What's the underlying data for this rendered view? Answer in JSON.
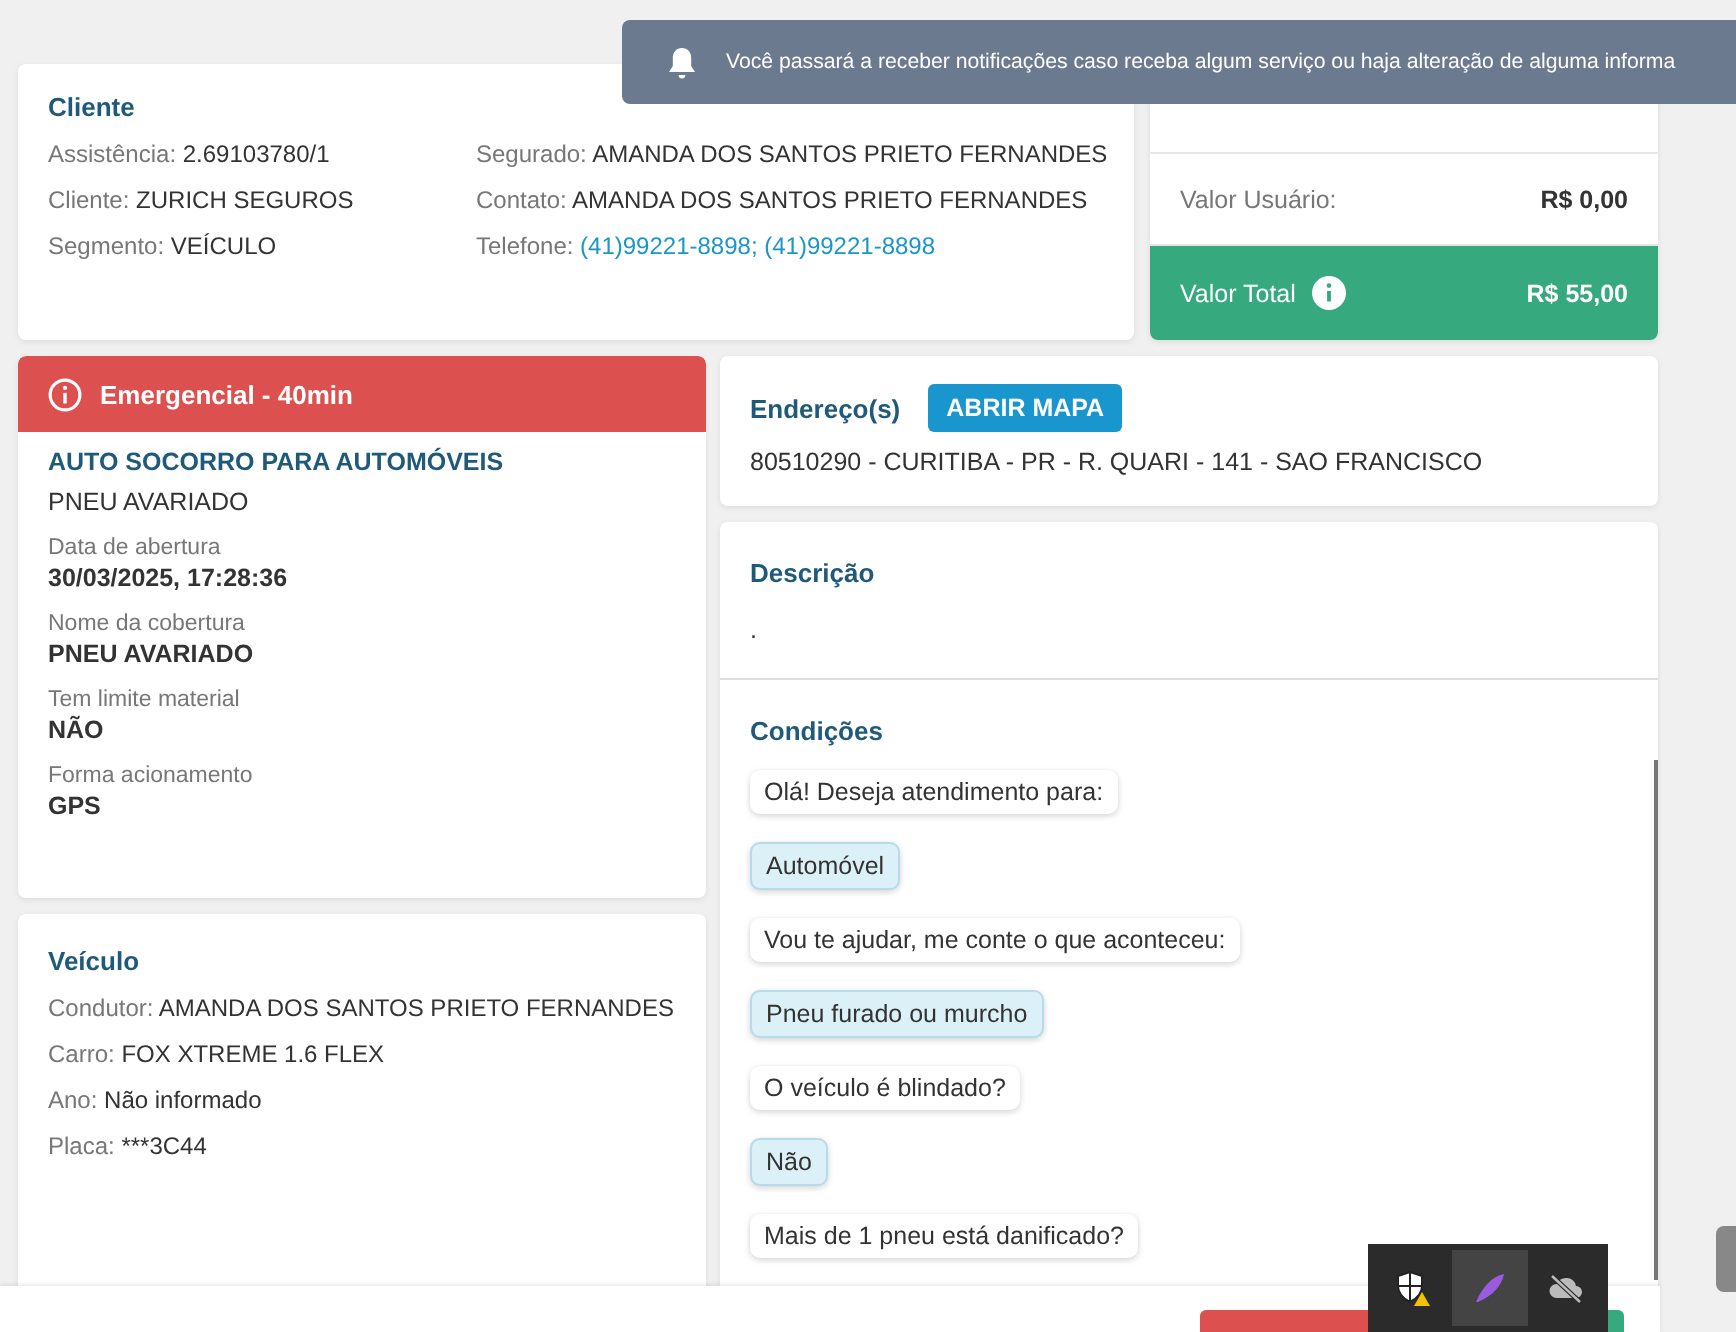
{
  "toast": {
    "text": "Você passará a receber notificações caso receba algum serviço ou haja alteração de alguma informa"
  },
  "client": {
    "title": "Cliente",
    "left": [
      {
        "label": "Assistência:",
        "value": "2.69103780/1"
      },
      {
        "label": "Cliente:",
        "value": "ZURICH SEGUROS"
      },
      {
        "label": "Segmento:",
        "value": "VEÍCULO"
      }
    ],
    "right": [
      {
        "label": "Segurado:",
        "value": "AMANDA DOS SANTOS PRIETO FERNANDES",
        "kind": "text"
      },
      {
        "label": "Contato:",
        "value": "AMANDA DOS SANTOS PRIETO FERNANDES",
        "kind": "text"
      },
      {
        "label": "Telefone:",
        "value": "(41)99221-8898; (41)99221-8898",
        "kind": "link"
      }
    ]
  },
  "values": [
    {
      "label": "Valor Usuário:",
      "amount": "R$ 0,00",
      "kind": "plain"
    },
    {
      "label": "Valor Total",
      "amount": "R$ 55,00",
      "kind": "total"
    }
  ],
  "service": {
    "banner": "Emergencial - 40min",
    "title": "AUTO SOCORRO PARA AUTOMÓVEIS",
    "subtitle": "PNEU AVARIADO",
    "fields": [
      {
        "label": "Data de abertura",
        "value": "30/03/2025, 17:28:36"
      },
      {
        "label": "Nome da cobertura",
        "value": "PNEU AVARIADO"
      },
      {
        "label": "Tem limite material",
        "value": "NÃO"
      },
      {
        "label": "Forma acionamento",
        "value": "GPS"
      }
    ]
  },
  "vehicle": {
    "title": "Veículo",
    "fields": [
      {
        "label": "Condutor:",
        "value": "AMANDA DOS SANTOS PRIETO FERNANDES"
      },
      {
        "label": "Carro:",
        "value": "FOX XTREME 1.6 FLEX"
      },
      {
        "label": "Ano:",
        "value": "Não informado"
      },
      {
        "label": "Placa:",
        "value": "***3C44"
      }
    ]
  },
  "address": {
    "title": "Endereço(s)",
    "button": "ABRIR MAPA",
    "text": "80510290 - CURITIBA - PR - R. QUARI - 141 - SAO FRANCISCO"
  },
  "description": {
    "title": "Descrição",
    "text": "."
  },
  "conditions": {
    "title": "Condições",
    "messages": [
      {
        "text": "Olá! Deseja atendimento para:",
        "kind": "question"
      },
      {
        "text": "Automóvel",
        "kind": "answer"
      },
      {
        "text": "Vou te ajudar, me conte o que aconteceu:",
        "kind": "question"
      },
      {
        "text": "Pneu furado ou murcho",
        "kind": "answer"
      },
      {
        "text": "O veículo é blindado?",
        "kind": "question"
      },
      {
        "text": "Não",
        "kind": "answer"
      },
      {
        "text": "Mais de 1 pneu está danificado?",
        "kind": "question"
      }
    ]
  }
}
